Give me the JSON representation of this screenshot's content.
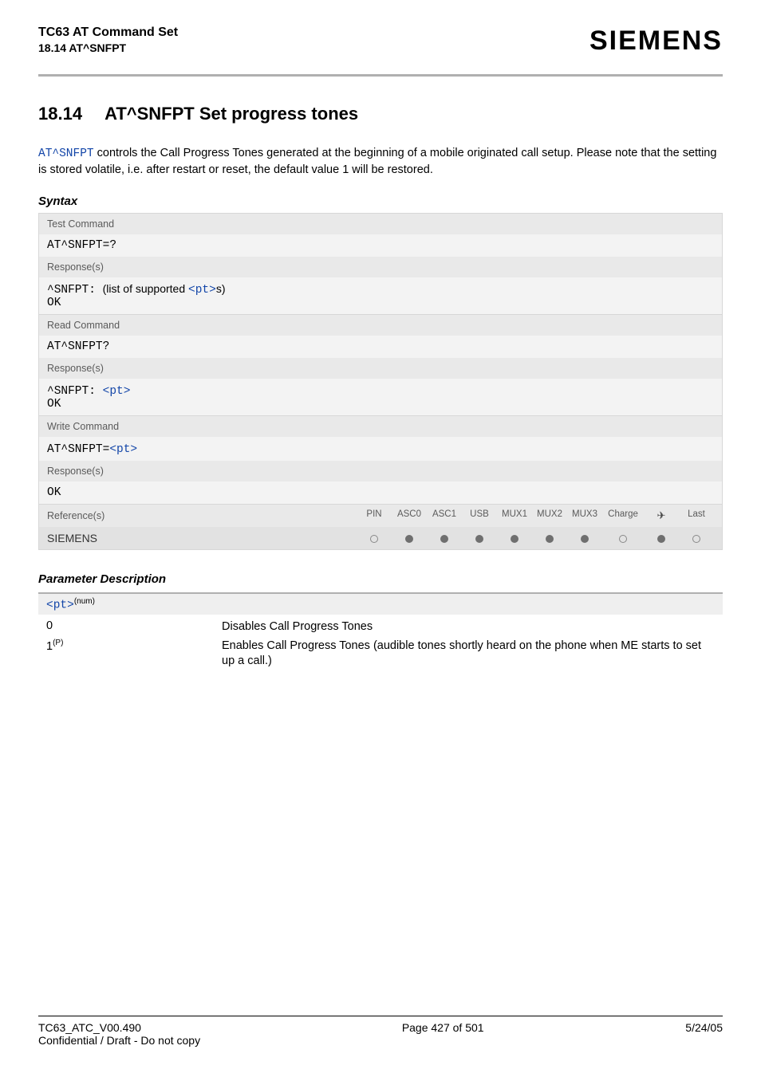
{
  "header": {
    "title_line1": "TC63 AT Command Set",
    "title_line2": "18.14 AT^SNFPT",
    "logo": "SIEMENS"
  },
  "section": {
    "number": "18.14",
    "title": "AT^SNFPT   Set progress tones"
  },
  "intro": {
    "cmd_link": "AT^SNFPT",
    "text_after": " controls the Call Progress Tones generated at the beginning of a mobile originated call setup. Please note that the setting is stored volatile, i.e. after restart or reset, the default value 1 will be restored."
  },
  "syntax": {
    "label": "Syntax",
    "test": {
      "head": "Test Command",
      "code": "AT^SNFPT=?",
      "resp_head": "Response(s)",
      "resp_prefix": "^SNFPT: ",
      "resp_text_before": "(list of supported ",
      "resp_pt": "<pt>",
      "resp_text_after": "s)",
      "ok": "OK"
    },
    "read": {
      "head": "Read Command",
      "code": "AT^SNFPT?",
      "resp_head": "Response(s)",
      "resp_prefix": "^SNFPT: ",
      "resp_pt": "<pt>",
      "ok": "OK"
    },
    "write": {
      "head": "Write Command",
      "code_prefix": "AT^SNFPT=",
      "code_pt": "<pt>",
      "resp_head": "Response(s)",
      "ok": "OK"
    },
    "ref": {
      "label": "Reference(s)",
      "cols": [
        "PIN",
        "ASC0",
        "ASC1",
        "USB",
        "MUX1",
        "MUX2",
        "MUX3",
        "Charge",
        "✈",
        "Last"
      ],
      "siemens": "SIEMENS",
      "dots": [
        "empty",
        "filled",
        "filled",
        "filled",
        "filled",
        "filled",
        "filled",
        "empty",
        "filled",
        "empty"
      ]
    }
  },
  "params": {
    "label": "Parameter Description",
    "name": "<pt>",
    "sup": "(num)",
    "rows": [
      {
        "key": "0",
        "val": "Disables Call Progress Tones"
      },
      {
        "key_html": "1",
        "key_sup": "(P)",
        "val": "Enables Call Progress Tones (audible tones shortly heard on the phone when ME starts to set up a call.)"
      }
    ]
  },
  "footer": {
    "left_line1": "TC63_ATC_V00.490",
    "left_line2": "Confidential / Draft - Do not copy",
    "center": "Page 427 of 501",
    "right": "5/24/05"
  }
}
